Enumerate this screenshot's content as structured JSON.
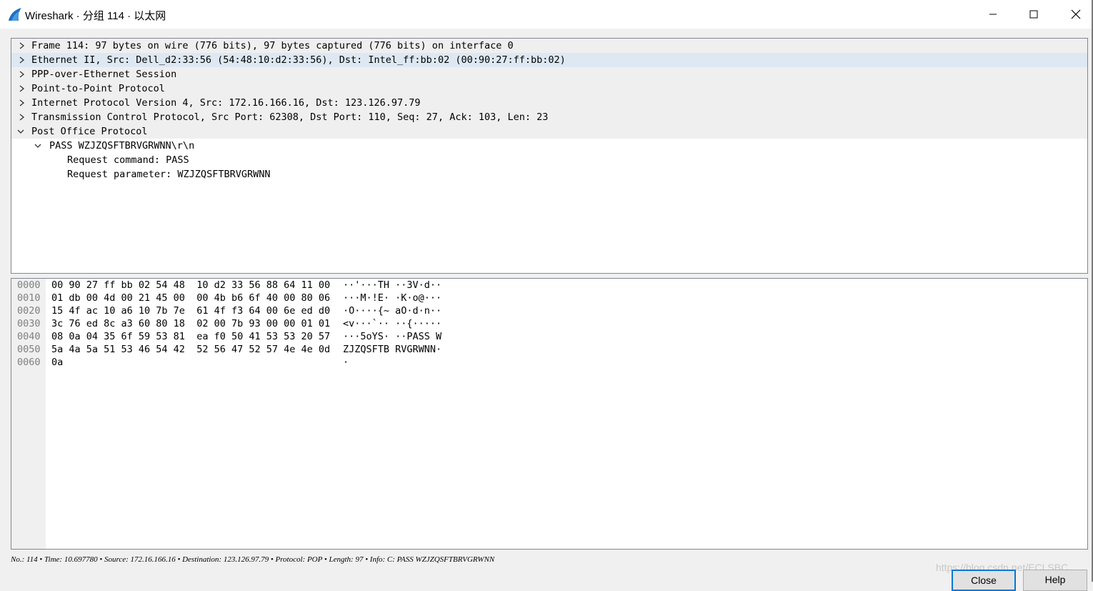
{
  "window": {
    "title": "Wireshark · 分组 114 · 以太网",
    "controls": [
      "minimize-icon",
      "maximize-icon",
      "close-icon"
    ]
  },
  "tree": {
    "rows": [
      {
        "text": "Frame 114: 97 bytes on wire (776 bits), 97 bytes captured (776 bits) on interface 0",
        "expanded": false,
        "level": 0
      },
      {
        "text": "Ethernet II, Src: Dell_d2:33:56 (54:48:10:d2:33:56), Dst: Intel_ff:bb:02 (00:90:27:ff:bb:02)",
        "expanded": false,
        "level": 0,
        "selected": true
      },
      {
        "text": "PPP-over-Ethernet Session",
        "expanded": false,
        "level": 0
      },
      {
        "text": "Point-to-Point Protocol",
        "expanded": false,
        "level": 0
      },
      {
        "text": "Internet Protocol Version 4, Src: 172.16.166.16, Dst: 123.126.97.79",
        "expanded": false,
        "level": 0
      },
      {
        "text": "Transmission Control Protocol, Src Port: 62308, Dst Port: 110, Seq: 27, Ack: 103, Len: 23",
        "expanded": false,
        "level": 0
      },
      {
        "text": "Post Office Protocol",
        "expanded": true,
        "level": 0
      },
      {
        "text": "PASS WZJZQSFTBRVGRWNN\\r\\n",
        "expanded": true,
        "level": 1
      },
      {
        "text": "Request command: PASS",
        "level": 2
      },
      {
        "text": "Request parameter: WZJZQSFTBRVGRWNN",
        "level": 2
      }
    ]
  },
  "hex": {
    "lines": [
      {
        "offset": "0000",
        "bytes": "00 90 27 ff bb 02 54 48  10 d2 33 56 88 64 11 00",
        "ascii": "··'···TH ··3V·d··"
      },
      {
        "offset": "0010",
        "bytes": "01 db 00 4d 00 21 45 00  00 4b b6 6f 40 00 80 06",
        "ascii": "···M·!E· ·K·o@···"
      },
      {
        "offset": "0020",
        "bytes": "15 4f ac 10 a6 10 7b 7e  61 4f f3 64 00 6e ed d0",
        "ascii": "·O····{~ aO·d·n··"
      },
      {
        "offset": "0030",
        "bytes": "3c 76 ed 8c a3 60 80 18  02 00 7b 93 00 00 01 01",
        "ascii": "<v···`·· ··{·····"
      },
      {
        "offset": "0040",
        "bytes": "08 0a 04 35 6f 59 53 81  ea f0 50 41 53 53 20 57",
        "ascii": "···5oYS· ··PASS W"
      },
      {
        "offset": "0050",
        "bytes": "5a 4a 5a 51 53 46 54 42  52 56 47 52 57 4e 4e 0d",
        "ascii": "ZJZQSFTB RVGRWNN·"
      },
      {
        "offset": "0060",
        "bytes": "0a",
        "ascii": "·"
      }
    ]
  },
  "status_bar": {
    "text": "No.: 114 • Time: 10.697780 • Source: 172.16.166.16 • Destination: 123.126.97.79 • Protocol: POP • Length: 97 • Info: C: PASS WZJZQSFTBRVGRWNN"
  },
  "buttons": {
    "close_label": "Close",
    "help_label": "Help"
  },
  "watermark": "https://blog.csdn.net/ECLSBC",
  "colors": {
    "selected_row": "#dde8f3",
    "header_row": "#efefef",
    "offset_text": "#808080",
    "wireshark_blue": "#1e6fc1"
  }
}
